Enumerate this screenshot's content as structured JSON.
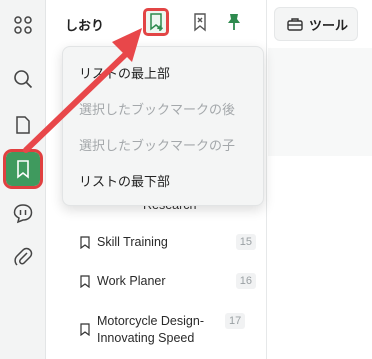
{
  "panel": {
    "title": "しおり",
    "partial_item": "Research"
  },
  "toolbar": {
    "tools_label": "ツール"
  },
  "menu": {
    "items": [
      {
        "label": "リストの最上部",
        "enabled": true
      },
      {
        "label": "選択したブックマークの後",
        "enabled": false
      },
      {
        "label": "選択したブックマークの子",
        "enabled": false
      },
      {
        "label": "リストの最下部",
        "enabled": true
      }
    ]
  },
  "bookmarks": [
    {
      "label": "Skill Training",
      "page": "15"
    },
    {
      "label": "Work Planer",
      "page": "16"
    },
    {
      "label": "Motorcycle Design-Innovating Speed",
      "page": "17"
    }
  ],
  "colors": {
    "accent_green": "#3f9a5e",
    "highlight_red": "#e04040"
  }
}
